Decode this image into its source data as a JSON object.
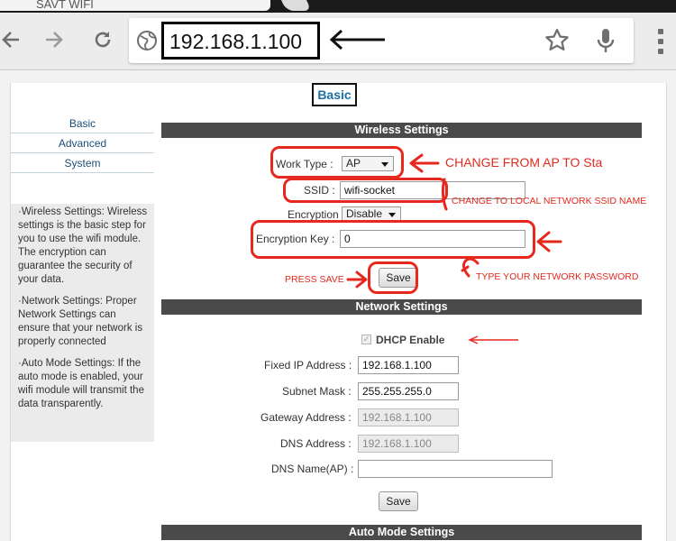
{
  "browser": {
    "tab_title": "SAVT WIFI",
    "url": "192.168.1.100",
    "icons": {
      "back": "back-arrow-icon",
      "forward": "forward-arrow-icon",
      "reload": "reload-icon",
      "site": "globe-icon",
      "bookmark": "star-icon",
      "voice": "microphone-icon",
      "menu": "more-vert-icon"
    }
  },
  "page": {
    "title": "Basic",
    "sidebar": {
      "items": [
        "Basic",
        "Advanced",
        "System"
      ],
      "help": [
        "·Wireless Settings: Wireless settings is the basic step for you to use the wifi module. The encryption can guarantee the security of your data.",
        "·Network Settings: Proper Network Settings can ensure that your network is properly connected",
        "·Auto Mode Settings: If the auto mode is enabled, your wifi module will transmit the data transparently."
      ]
    },
    "wireless": {
      "header": "Wireless Settings",
      "work_type_label": "Work Type :",
      "work_type_value": "AP",
      "ssid_label": "SSID :",
      "ssid_value": "wifi-socket",
      "encryption_label": "Encryption :",
      "encryption_value": "Disable",
      "key_label": "Encryption Key :",
      "key_value": "0",
      "save_label": "Save"
    },
    "network": {
      "header": "Network Settings",
      "dhcp_label": "DHCP Enable",
      "dhcp_checked": true,
      "fixed_ip_label": "Fixed IP Address :",
      "fixed_ip_value": "192.168.1.100",
      "subnet_label": "Subnet Mask :",
      "subnet_value": "255.255.255.0",
      "gateway_label": "Gateway Address :",
      "gateway_value": "192.168.1.100",
      "dns_label": "DNS Address :",
      "dns_value": "192.168.1.100",
      "dns_name_label": "DNS Name(AP) :",
      "dns_name_value": "",
      "save_label": "Save"
    },
    "auto_mode": {
      "header": "Auto Mode Settings"
    }
  },
  "annotations": {
    "change_ap": "CHANGE FROM AP TO Sta",
    "change_ssid": "CHANGE TO LOCAL NETWORK SSID NAME",
    "press_save": "PRESS SAVE",
    "type_password": "TYPE YOUR NETWORK PASSWORD",
    "color": "#e12a1e"
  }
}
